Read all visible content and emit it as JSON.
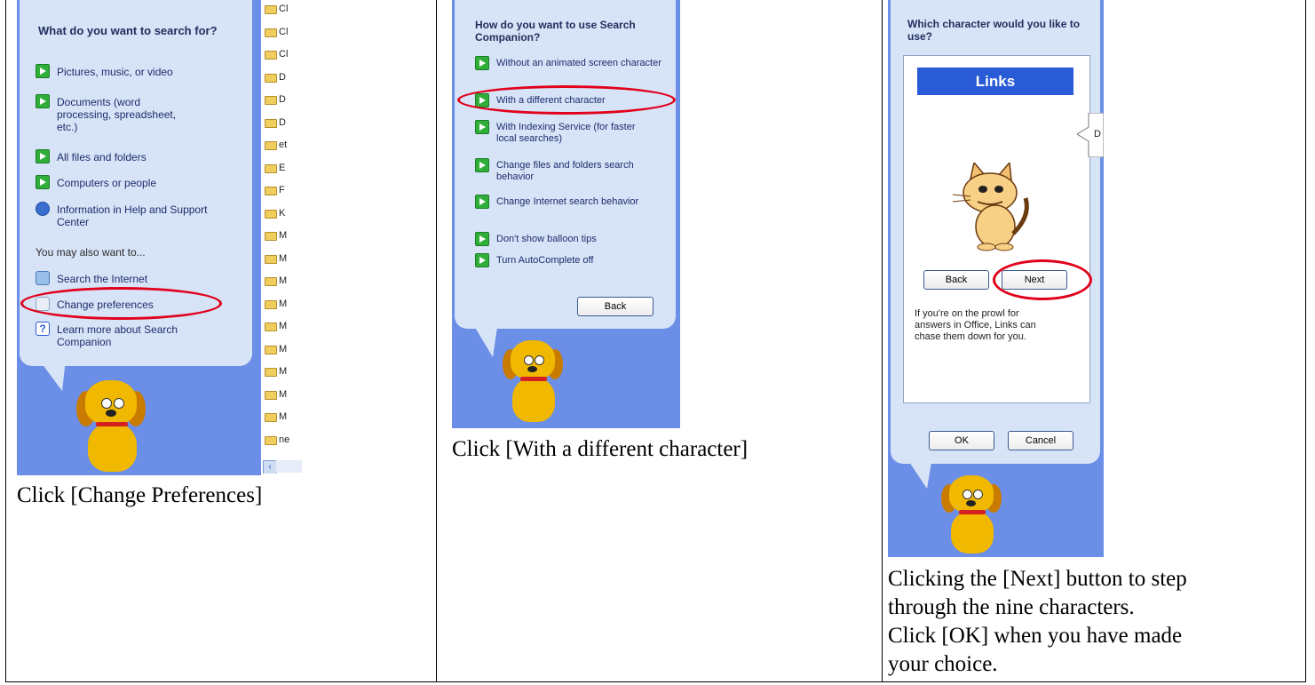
{
  "panel1": {
    "title": "What do you want to search for?",
    "items": [
      "Pictures, music, or video",
      "Documents (word processing, spreadsheet, etc.)",
      "All files and folders",
      "Computers or people",
      "Information in Help and Support Center"
    ],
    "also_label": "You may also want to...",
    "also_items": [
      "Search the Internet",
      "Change preferences",
      "Learn more about Search Companion"
    ],
    "folder_letters": [
      "Cl",
      "Cl",
      "Cl",
      "D",
      "D",
      "D",
      "et",
      "E",
      "F",
      "K",
      "M",
      "M",
      "M",
      "M",
      "M",
      "M",
      "M",
      "M",
      "M",
      "ne"
    ],
    "caption": "Click [Change Preferences]"
  },
  "panel2": {
    "title": "How do you want to use Search Companion?",
    "items": [
      "Without an animated screen character",
      "With a different character",
      "With Indexing Service (for faster local searches)",
      "Change files and folders search behavior",
      "Change Internet search behavior",
      "Don't show balloon tips",
      "Turn AutoComplete off"
    ],
    "back_label": "Back",
    "caption": "Click [With a different character]"
  },
  "panel3": {
    "title": "Which character would you like to use?",
    "character_name": "Links",
    "speech_text": "D",
    "back_label": "Back",
    "next_label": "Next",
    "description": "If you're on the prowl for answers in Office, Links can chase them down for you.",
    "ok_label": "OK",
    "cancel_label": "Cancel",
    "caption_lines": [
      "Clicking the [Next] button to step",
      "through the nine characters.",
      "Click [OK] when you have made",
      "your choice."
    ]
  },
  "colors": {
    "highlight_oval": "#e1001b",
    "balloon": "#d7e3f7",
    "background_blue": "#6b8ee6",
    "title_bar_blue": "#2a5bd7",
    "arrow_green": "#2fae3a"
  }
}
